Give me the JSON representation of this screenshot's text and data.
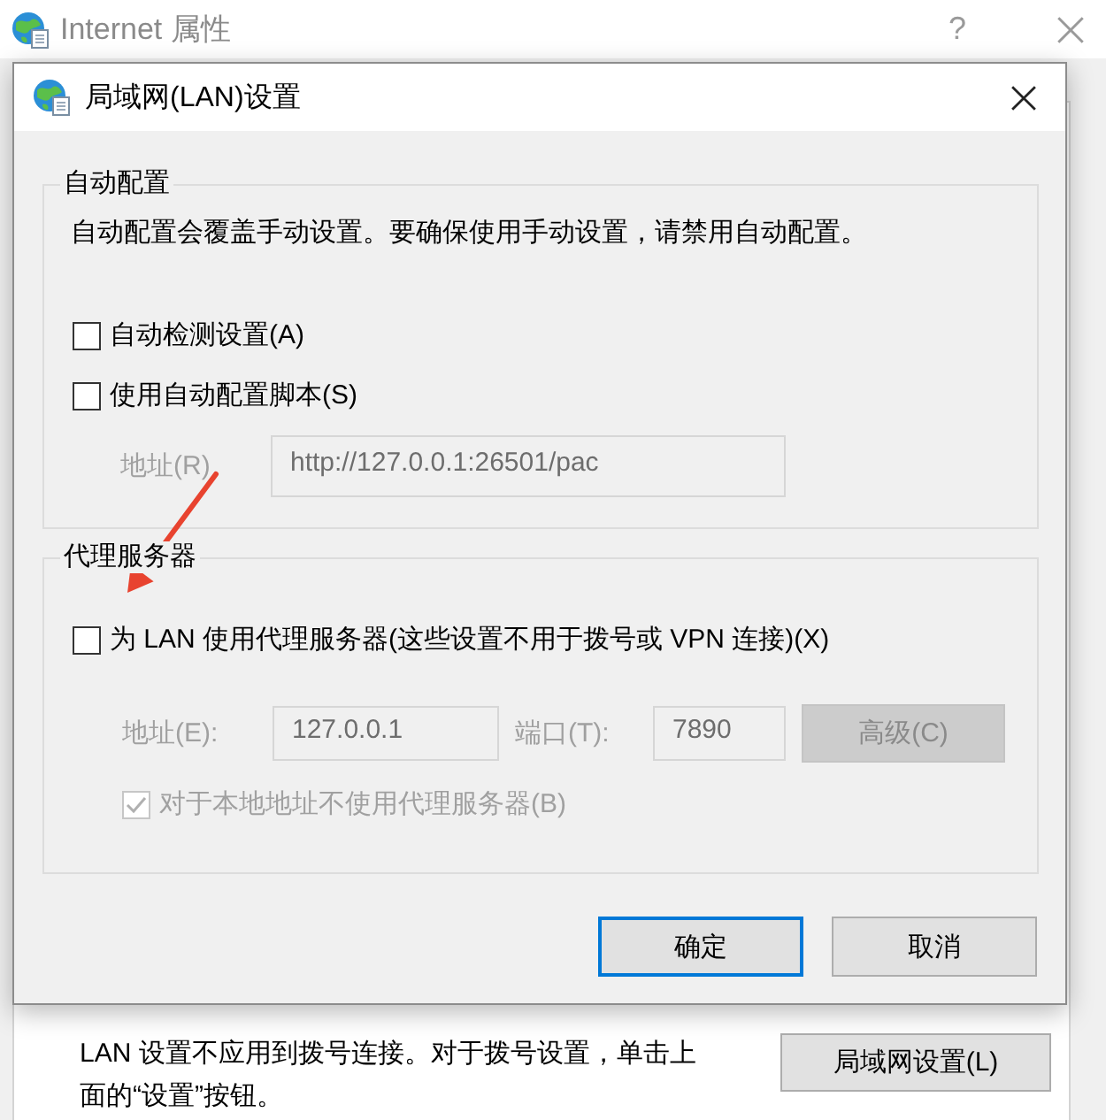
{
  "background_window": {
    "title": "Internet 属性",
    "help_button": "?",
    "lan_section": {
      "description": "LAN 设置不应用到拨号连接。对于拨号设置，单击上面的“设置”按钮。",
      "button": "局域网设置(L)"
    }
  },
  "dialog": {
    "title": "局域网(LAN)设置",
    "auto_config": {
      "title": "自动配置",
      "description": "自动配置会覆盖手动设置。要确保使用手动设置，请禁用自动配置。",
      "options": [
        {
          "label": "自动检测设置(A)",
          "checked": false
        },
        {
          "label": "使用自动配置脚本(S)",
          "checked": false
        }
      ],
      "address": {
        "label": "地址(R)",
        "value": "http://127.0.0.1:26501/pac",
        "disabled": true
      }
    },
    "proxy_server": {
      "title": "代理服务器",
      "use_proxy": {
        "label": "为 LAN 使用代理服务器(这些设置不用于拨号或 VPN 连接)(X)",
        "checked": false
      },
      "address": {
        "label": "地址(E):",
        "value": "127.0.0.1",
        "disabled": true
      },
      "port": {
        "label": "端口(T):",
        "value": "7890",
        "disabled": true
      },
      "advanced_button": {
        "label": "高级(C)",
        "disabled": true
      },
      "bypass_local": {
        "label": "对于本地地址不使用代理服务器(B)",
        "checked": true,
        "disabled": true
      }
    },
    "buttons": [
      {
        "label": "确定",
        "default": true
      },
      {
        "label": "取消",
        "default": false
      }
    ]
  }
}
